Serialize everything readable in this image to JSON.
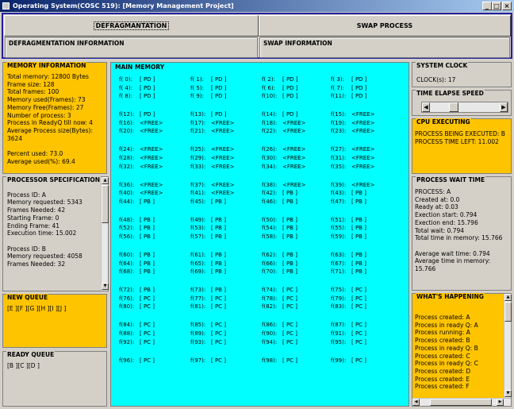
{
  "window": {
    "title": "Operating System(COSC 519): [Memory Management Project]"
  },
  "top": {
    "defrag_label": "DEFRAGMANTATION",
    "swap_label": "SWAP PROCESS",
    "defrag_info_label": "DEFRAGMENTATION INFORMATION",
    "swap_info_label": "SWAP INFORMATION"
  },
  "memory_info": {
    "title": "MEMORY INFORMATION",
    "lines": [
      "Total memory: 12800 Bytes",
      "Frame size: 128",
      "Total frames: 100",
      "Memory used(Frames): 73",
      "Memory Free(Frames): 27",
      "Number of process: 3",
      "Process in ReadyQ till now: 4",
      "Average Process size(Bytes): 3624",
      "",
      "Percent used: 73.0",
      "Average used(%): 69.4"
    ]
  },
  "processor_spec": {
    "title": "PROCESSOR SPECIFICATION",
    "lines": [
      "",
      "Process ID: A",
      "Memory requested: 5343",
      "Frames Needed: 42",
      "Starting Frame: 0",
      "Ending Frame: 41",
      "Execution time: 15.002",
      "",
      "Process ID: B",
      "Memory requested: 4058",
      "Frames Needed: 32"
    ]
  },
  "new_queue": {
    "title": "NEW QUEUE",
    "text": "[E ][F ][G ][H ][I ][J ]"
  },
  "ready_queue": {
    "title": "READY QUEUE",
    "text": "[B ][C ][D ]"
  },
  "main_memory": {
    "title": "MAIN MEMORY",
    "frames": [
      "[ PD ]",
      "[ PD ]",
      "[ PD ]",
      "[ PD ]",
      "[ PD ]",
      "[ PD ]",
      "[ PD ]",
      "[ PD ]",
      "[ PD ]",
      "[ PD ]",
      "[ PD ]",
      "[ PD ]",
      "[ PD ]",
      "[ PD ]",
      "[ PD ]",
      "<FREE>",
      "<FREE>",
      "<FREE>",
      "<FREE>",
      "<FREE>",
      "<FREE>",
      "<FREE>",
      "<FREE>",
      "<FREE>",
      "<FREE>",
      "<FREE>",
      "<FREE>",
      "<FREE>",
      "<FREE>",
      "<FREE>",
      "<FREE>",
      "<FREE>",
      "<FREE>",
      "<FREE>",
      "<FREE>",
      "<FREE>",
      "<FREE>",
      "<FREE>",
      "<FREE>",
      "<FREE>",
      "<FREE>",
      "<FREE>",
      "[ PB ]",
      "[ PB ]",
      "[ PB ]",
      "[ PB ]",
      "[ PB ]",
      "[ PB ]",
      "[ PB ]",
      "[ PB ]",
      "[ PB ]",
      "[ PB ]",
      "[ PB ]",
      "[ PB ]",
      "[ PB ]",
      "[ PB ]",
      "[ PB ]",
      "[ PB ]",
      "[ PB ]",
      "[ PB ]",
      "[ PB ]",
      "[ PB ]",
      "[ PB ]",
      "[ PB ]",
      "[ PB ]",
      "[ PB ]",
      "[ PB ]",
      "[ PB ]",
      "[ PB ]",
      "[ PB ]",
      "[ PB ]",
      "[ PB ]",
      "[ PB ]",
      "[ PB ]",
      "[ PC ]",
      "[ PC ]",
      "[ PC ]",
      "[ PC ]",
      "[ PC ]",
      "[ PC ]",
      "[ PC ]",
      "[ PC ]",
      "[ PC ]",
      "[ PC ]",
      "[ PC ]",
      "[ PC ]",
      "[ PC ]",
      "[ PC ]",
      "[ PC ]",
      "[ PC ]",
      "[ PC ]",
      "[ PC ]",
      "[ PC ]",
      "[ PC ]",
      "[ PC ]",
      "[ PC ]",
      "[ PC ]",
      "[ PC ]",
      "[ PC ]",
      "[ PC ]"
    ]
  },
  "clock": {
    "title": "SYSTEM CLOCK",
    "text": "CLOCK(s): 17"
  },
  "speed": {
    "title": "TIME ELAPSE SPEED",
    "level": 0.3
  },
  "cpu": {
    "title": "CPU EXECUTING",
    "lines": [
      "PROCESS BEING EXECUTED: B",
      "PROCESS TIME LEFT: 11.002"
    ]
  },
  "wait_time": {
    "title": "PROCESS WAIT TIME",
    "lines": [
      "PROCESS: A",
      "Created at: 0.0",
      "Ready at: 0.03",
      "Exection start: 0.794",
      "Exection end: 15.796",
      "Total wait: 0.794",
      "Total time in memory: 15.766",
      "",
      "Average wait time: 0.794",
      "Average time in memory: 15.766"
    ]
  },
  "happening": {
    "title": "WHAT'S HAPPENING",
    "lines": [
      "Process created: A",
      "Process in ready Q: A",
      "Process running: A",
      "Process created: B",
      "Process in ready Q: B",
      "Process created: C",
      "Process in ready Q: C",
      "Process created: D",
      "Process created: E",
      "Process created: F"
    ]
  }
}
